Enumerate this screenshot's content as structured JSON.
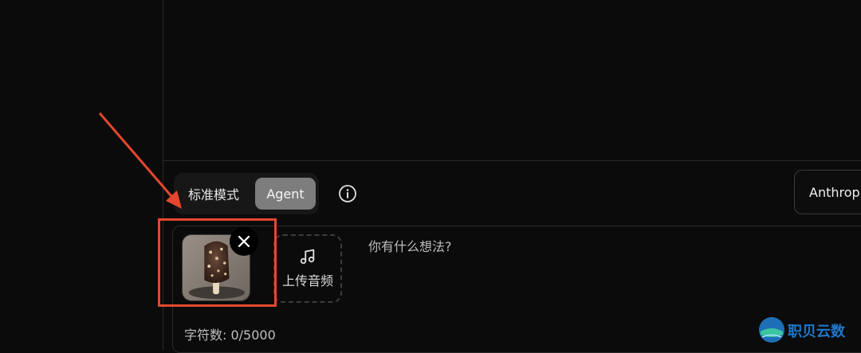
{
  "mode_toggle": {
    "standard_label": "标准模式",
    "agent_label": "Agent",
    "active": "Agent"
  },
  "model_select": {
    "value": "Anthrop"
  },
  "attachment": {
    "image_description": "chocolate ice cream bar"
  },
  "upload_audio": {
    "label": "上传音频"
  },
  "prompt": {
    "placeholder": "你有什么想法?",
    "value": ""
  },
  "char_count": {
    "text": "字符数: 0/5000"
  },
  "watermark": {
    "text": "职贝云数"
  },
  "colors": {
    "accent_red": "#e5472e",
    "agent_active_bg": "#7d7d7d",
    "background": "#0b0b0b"
  },
  "icons": [
    "info-icon",
    "close-icon",
    "music-note-icon",
    "arrow-icon"
  ]
}
